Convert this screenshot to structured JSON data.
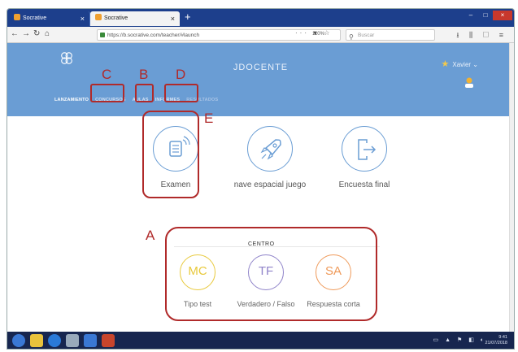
{
  "browser": {
    "tabs": [
      {
        "title": "Socrative"
      },
      {
        "title": "Socrative"
      }
    ],
    "url": "https://b.socrative.com/teacher/#launch",
    "zoom": "110%",
    "search_placeholder": "Buscar"
  },
  "app": {
    "title": "JDOCENTE",
    "user_name": "Xavier",
    "nav_tabs": [
      "LANZAMIENTO",
      "CONCURSOS",
      "AULAS",
      "INFORMES",
      "RESULTADOS"
    ]
  },
  "launch_items": [
    {
      "label": "Examen",
      "icon": "document-signal-icon"
    },
    {
      "label": "nave espacial juego",
      "icon": "rocket-icon"
    },
    {
      "label": "Encuesta final",
      "icon": "exit-icon"
    }
  ],
  "quick_section": {
    "title": "CENTRO",
    "items": [
      {
        "abbr": "MC",
        "label": "Tipo test",
        "color": "#e8c93c"
      },
      {
        "abbr": "TF",
        "label": "Verdadero / Falso",
        "color": "#8f83c9"
      },
      {
        "abbr": "SA",
        "label": "Respuesta corta",
        "color": "#ef9a5a"
      }
    ]
  },
  "annotations": [
    "A",
    "B",
    "C",
    "D",
    "E"
  ],
  "annotation_color": "#b02a2a",
  "taskbar": {
    "time": "9:41",
    "date": "21/07/2018"
  }
}
